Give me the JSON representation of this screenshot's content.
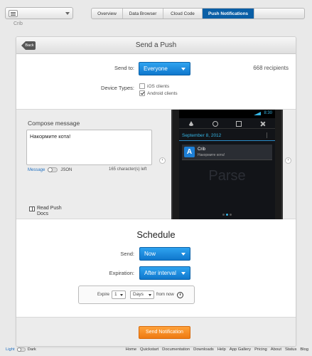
{
  "header": {
    "app_name": "Crib",
    "tabs": [
      {
        "label": "Overview",
        "active": false
      },
      {
        "label": "Data Browser",
        "active": false
      },
      {
        "label": "Cloud Code",
        "active": false
      },
      {
        "label": "Push Notifications",
        "active": true
      }
    ]
  },
  "panel": {
    "back_label": "Back",
    "title": "Send a Push",
    "send_to_label": "Send to:",
    "send_to_value": "Everyone",
    "recipients": "668 recipients",
    "device_types_label": "Device Types:",
    "device_types": [
      {
        "label": "iOS clients",
        "checked": false
      },
      {
        "label": "Android clients",
        "checked": true
      }
    ]
  },
  "compose": {
    "title": "Compose message",
    "message": "Накормите кота!",
    "message_label": "Message",
    "json_label": "JSON",
    "chars_left": "165 character(s) left",
    "docs_link": "Read Push\nDocs"
  },
  "phone_preview": {
    "time": "8:30",
    "date": "September 8, 2012",
    "notif_title": "Crib",
    "notif_body": "Накормите кота!",
    "watermark": "Parse"
  },
  "schedule": {
    "title": "Schedule",
    "send_label": "Send:",
    "send_value": "Now",
    "expiration_label": "Expiration:",
    "expiration_value": "After interval",
    "expire_prefix": "Expire",
    "expire_amount": "1",
    "expire_unit": "Days",
    "expire_suffix": "from now"
  },
  "actions": {
    "send_button": "Send Notification"
  },
  "footer": {
    "theme_light": "Light",
    "theme_dark": "Dark",
    "links": [
      "Home",
      "Quickstart",
      "Documentation",
      "Downloads",
      "Help",
      "App Gallery",
      "Pricing",
      "About",
      "Status",
      "Blog"
    ]
  },
  "colors": {
    "accent_blue": "#0f77cc",
    "send_orange": "#ee7a12",
    "active_tab": "#0a5fa6"
  }
}
